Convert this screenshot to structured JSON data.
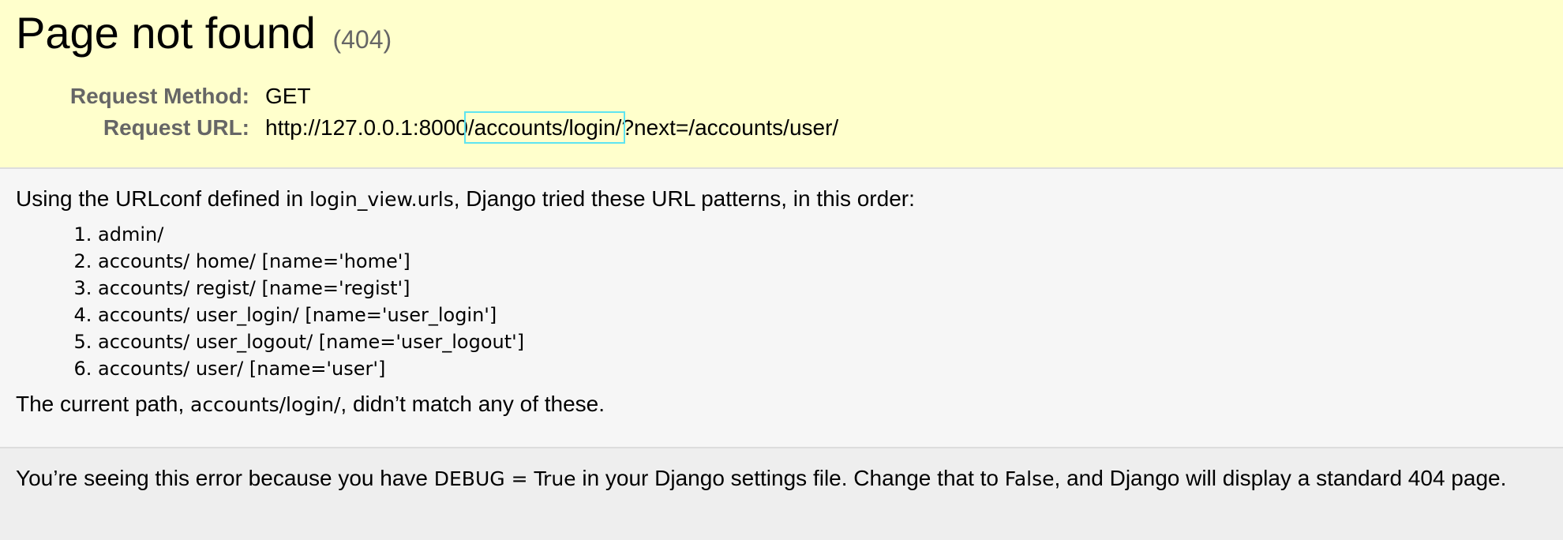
{
  "summary": {
    "title": "Page not found",
    "status": "(404)",
    "request_method_label": "Request Method:",
    "request_method_value": "GET",
    "request_url_label": "Request URL:",
    "request_url_prefix": "http://127.0.0.1:8000",
    "request_url_highlight": "/accounts/login/",
    "request_url_suffix": "?next=/accounts/user/"
  },
  "info": {
    "intro_before": "Using the URLconf defined in ",
    "urlconf": "login_view.urls",
    "intro_after": ", Django tried these URL patterns, in this order:",
    "patterns": [
      "admin/",
      "accounts/ home/ [name='home']",
      "accounts/ regist/ [name='regist']",
      "accounts/ user_login/ [name='user_login']",
      "accounts/ user_logout/ [name='user_logout']",
      "accounts/ user/ [name='user']"
    ],
    "current_before": "The current path, ",
    "current_path": "accounts/login/",
    "current_after": ", didn’t match any of these."
  },
  "explanation": {
    "part1": "You’re seeing this error because you have ",
    "debug_code": "DEBUG = True",
    "part2": " in your Django settings file. Change that to ",
    "false_code": "False",
    "part3": ", and Django will display a standard 404 page."
  },
  "colors": {
    "summary_bg": "#ffffcc",
    "info_bg": "#f6f6f6",
    "explanation_bg": "#eeeeee",
    "highlight_outline": "#5ee4f0",
    "muted_text": "#666666"
  }
}
